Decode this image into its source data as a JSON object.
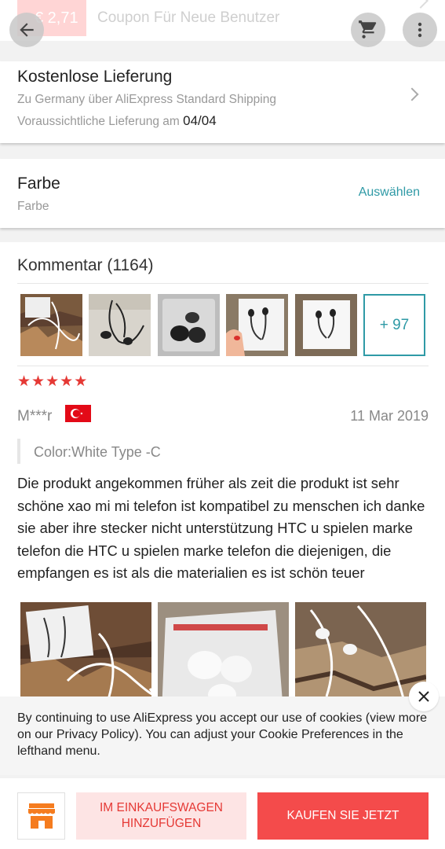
{
  "coupon": {
    "amount": "€ 2,71",
    "text": "Coupon Für Neue Benutzer"
  },
  "top_bar": {
    "back_icon": "arrow-left-icon",
    "cart_icon": "cart-icon",
    "more_icon": "vertical-dots-icon"
  },
  "shipping": {
    "title": "Kostenlose Lieferung",
    "subtitle": "Zu Germany über AliExpress Standard Shipping",
    "eta_label": "Voraussichtliche Lieferung am",
    "eta_date": "04/04"
  },
  "color": {
    "title": "Farbe",
    "subtitle": "Farbe",
    "select_label": "Auswählen"
  },
  "reviews": {
    "heading": "Kommentar (1164)",
    "more_images_label": "+ 97",
    "first_review": {
      "rating": 5,
      "reviewer": "M***r",
      "country": "Turkey",
      "date": "11 Mar 2019",
      "attribute": "Color:White Type -C",
      "text": "Die produkt angekommen früher als zeit die produkt ist sehr schöne xao mi mi telefon ist kompatibel zu menschen ich danke sie aber ihre stecker nicht unterstützung HTC u spielen marke telefon die HTC u spielen marke telefon die diejenigen, die empfangen es ist als die materialien es ist schön teuer"
    }
  },
  "cookie_banner": {
    "text": "By continuing to use AliExpress you accept our use of cookies (view more on our Privacy Policy). You can adjust your Cookie Preferences in the lefthand menu."
  },
  "actions": {
    "store_icon": "store-icon",
    "add_to_cart": "IM EINKAUFSWAGEN HINZUFÜGEN",
    "buy_now": "KAUFEN SIE JETZT"
  },
  "colors": {
    "accent": "#f44b4b",
    "teal": "#2f9aa6",
    "star": "#e53935"
  }
}
